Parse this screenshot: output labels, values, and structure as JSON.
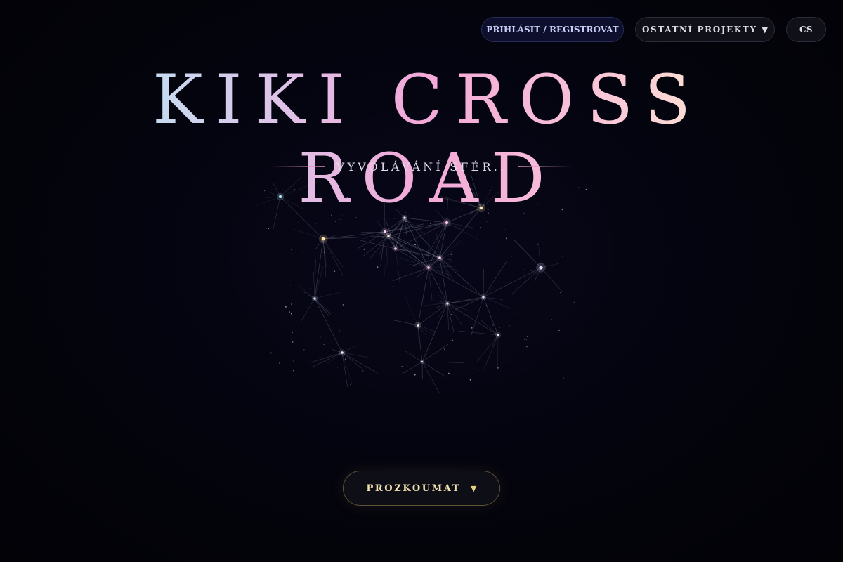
{
  "nav": {
    "login_label": "PŘIHLÁSIT / REGISTROVAT",
    "projects_label": "OSTATNÍ PROJEKTY",
    "projects_icon": "caret-down-icon",
    "language_label": "CS"
  },
  "hero": {
    "title": "KIKI CROSS ROAD",
    "subtitle": "VYVOLÁVÁNÍ SFÉR..",
    "title_gradient": [
      "#8eeefb",
      "#dcc4e8",
      "#f3a8d8",
      "#fff3c8"
    ]
  },
  "explore": {
    "label": "PROZKOUMAT",
    "icon": "caret-down-icon"
  },
  "colors": {
    "background": "#04040c",
    "accent_gold": "#e9cf7e",
    "login_bg": "#0d0f2c"
  }
}
